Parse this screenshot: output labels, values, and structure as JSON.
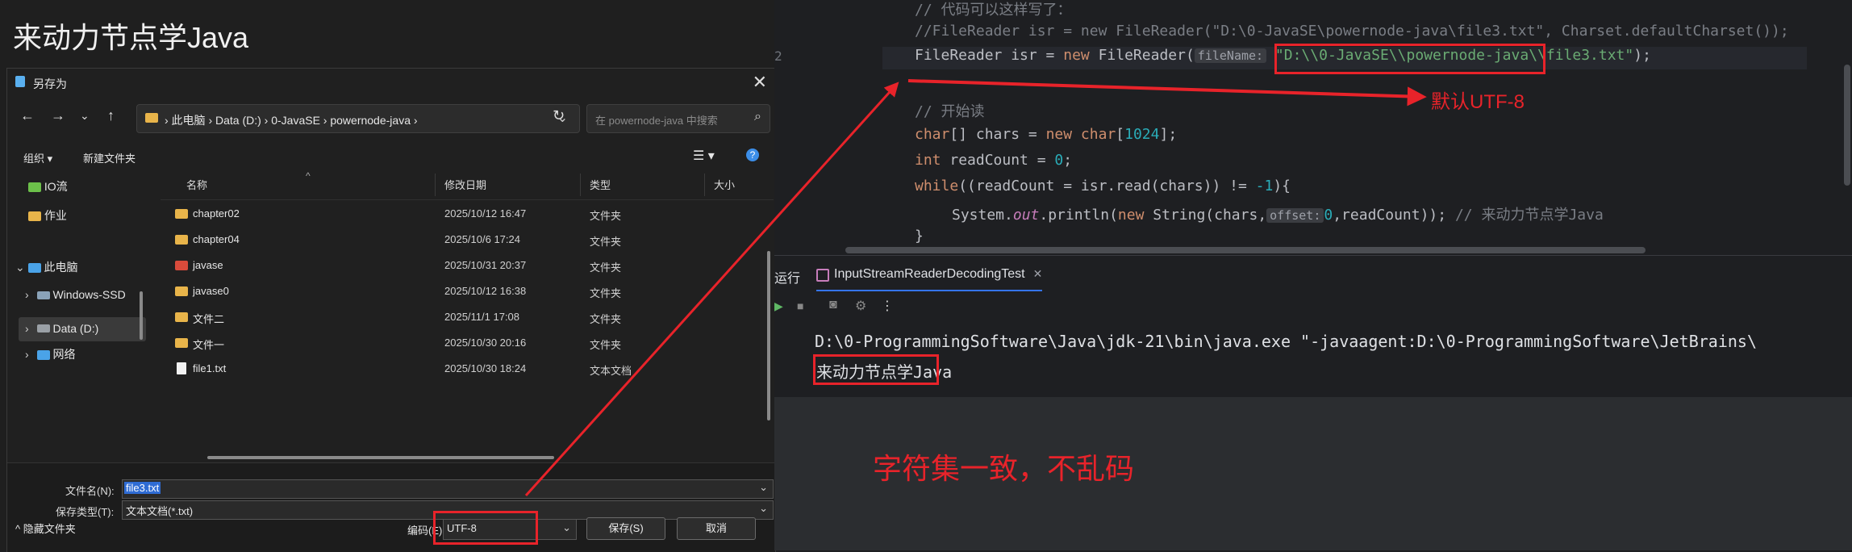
{
  "slide_title": "来动力节点学Java",
  "dialog": {
    "title": "另存为",
    "nav": {
      "back": "←",
      "forward": "→",
      "recent": "⌄",
      "up": "↑",
      "path": "› 此电脑 › Data (D:) › 0-JavaSE › powernode-java ›",
      "search_placeholder": "在 powernode-java 中搜索"
    },
    "toolbar": {
      "organize": "组织 ▾",
      "new_folder": "新建文件夹"
    },
    "sidebar": [
      {
        "label": "IO流"
      },
      {
        "label": "作业"
      },
      {
        "label": "此电脑"
      },
      {
        "label": "Windows-SSD"
      },
      {
        "label": "Data (D:)"
      },
      {
        "label": "网络"
      }
    ],
    "columns": {
      "name": "名称",
      "date": "修改日期",
      "type": "类型",
      "size": "大小"
    },
    "rows": [
      {
        "name": "chapter02",
        "date": "2025/10/12 16:47",
        "type": "文件夹"
      },
      {
        "name": "chapter04",
        "date": "2025/10/6 17:24",
        "type": "文件夹"
      },
      {
        "name": "javase",
        "date": "2025/10/31 20:37",
        "type": "文件夹"
      },
      {
        "name": "javase0",
        "date": "2025/10/12 16:38",
        "type": "文件夹"
      },
      {
        "name": "文件二",
        "date": "2025/11/1 17:08",
        "type": "文件夹"
      },
      {
        "name": "文件一",
        "date": "2025/10/30 20:16",
        "type": "文件夹"
      },
      {
        "name": "file1.txt",
        "date": "2025/10/30 18:24",
        "type": "文本文档"
      }
    ],
    "filename_label": "文件名(N):",
    "filename_value": "file3.txt",
    "savetype_label": "保存类型(T):",
    "savetype_value": "文本文档(*.txt)",
    "hide_folders": "隐藏文件夹",
    "encoding_label": "编码(E):",
    "encoding_value": "UTF-8",
    "save_button": "保存(S)",
    "cancel_button": "取消"
  },
  "editor": {
    "line_number": "2",
    "line1": "// 代码可以这样写了：",
    "line2": "//FileReader isr = new FileReader(\"D:\\0-JavaSE\\powernode-java\\file3.txt\", Charset.defaultCharset());",
    "line3_pre": "FileReader isr = ",
    "line3_new": "new",
    "line3_mid": " FileReader(",
    "line3_hint": "fileName:",
    "line3_str": "\"D:\\\\0-JavaSE\\\\powernode-java\\\\file3.txt\"",
    "line3_post": ");",
    "line4": "// 开始读",
    "line5_kw": "char",
    "line5_a": "[] chars = ",
    "line5_new": "new",
    "line5_kw2": " char",
    "line5_b": "[",
    "line5_num": "1024",
    "line5_c": "];",
    "line6_kw": "int",
    "line6_a": " readCount = ",
    "line6_num": "0",
    "line6_b": ";",
    "line7_kw": "while",
    "line7_a": "((readCount = isr.read(chars)) != ",
    "line7_num": "-1",
    "line7_b": "){",
    "line8_a": "System.",
    "line8_fld": "out",
    "line8_b": ".println(",
    "line8_new": "new",
    "line8_c": " String(chars,",
    "line8_hint": "offset:",
    "line8_num": "0",
    "line8_d": ",readCount)); ",
    "line8_cm": "// 来动力节点学Java",
    "line9": "}"
  },
  "run_panel": {
    "tool_label": "运行",
    "tab_label": "InputStreamReaderDecodingTest",
    "command": "D:\\0-ProgrammingSoftware\\Java\\jdk-21\\bin\\java.exe \"-javaagent:D:\\0-ProgrammingSoftware\\JetBrains\\",
    "output": "来动力节点学Java"
  },
  "annotations": {
    "default_utf8": "默认UTF-8",
    "conclusion": "字符集一致，不乱码"
  },
  "colors": {
    "accent_red": "#e8232a",
    "folder": "#e8b44a"
  }
}
